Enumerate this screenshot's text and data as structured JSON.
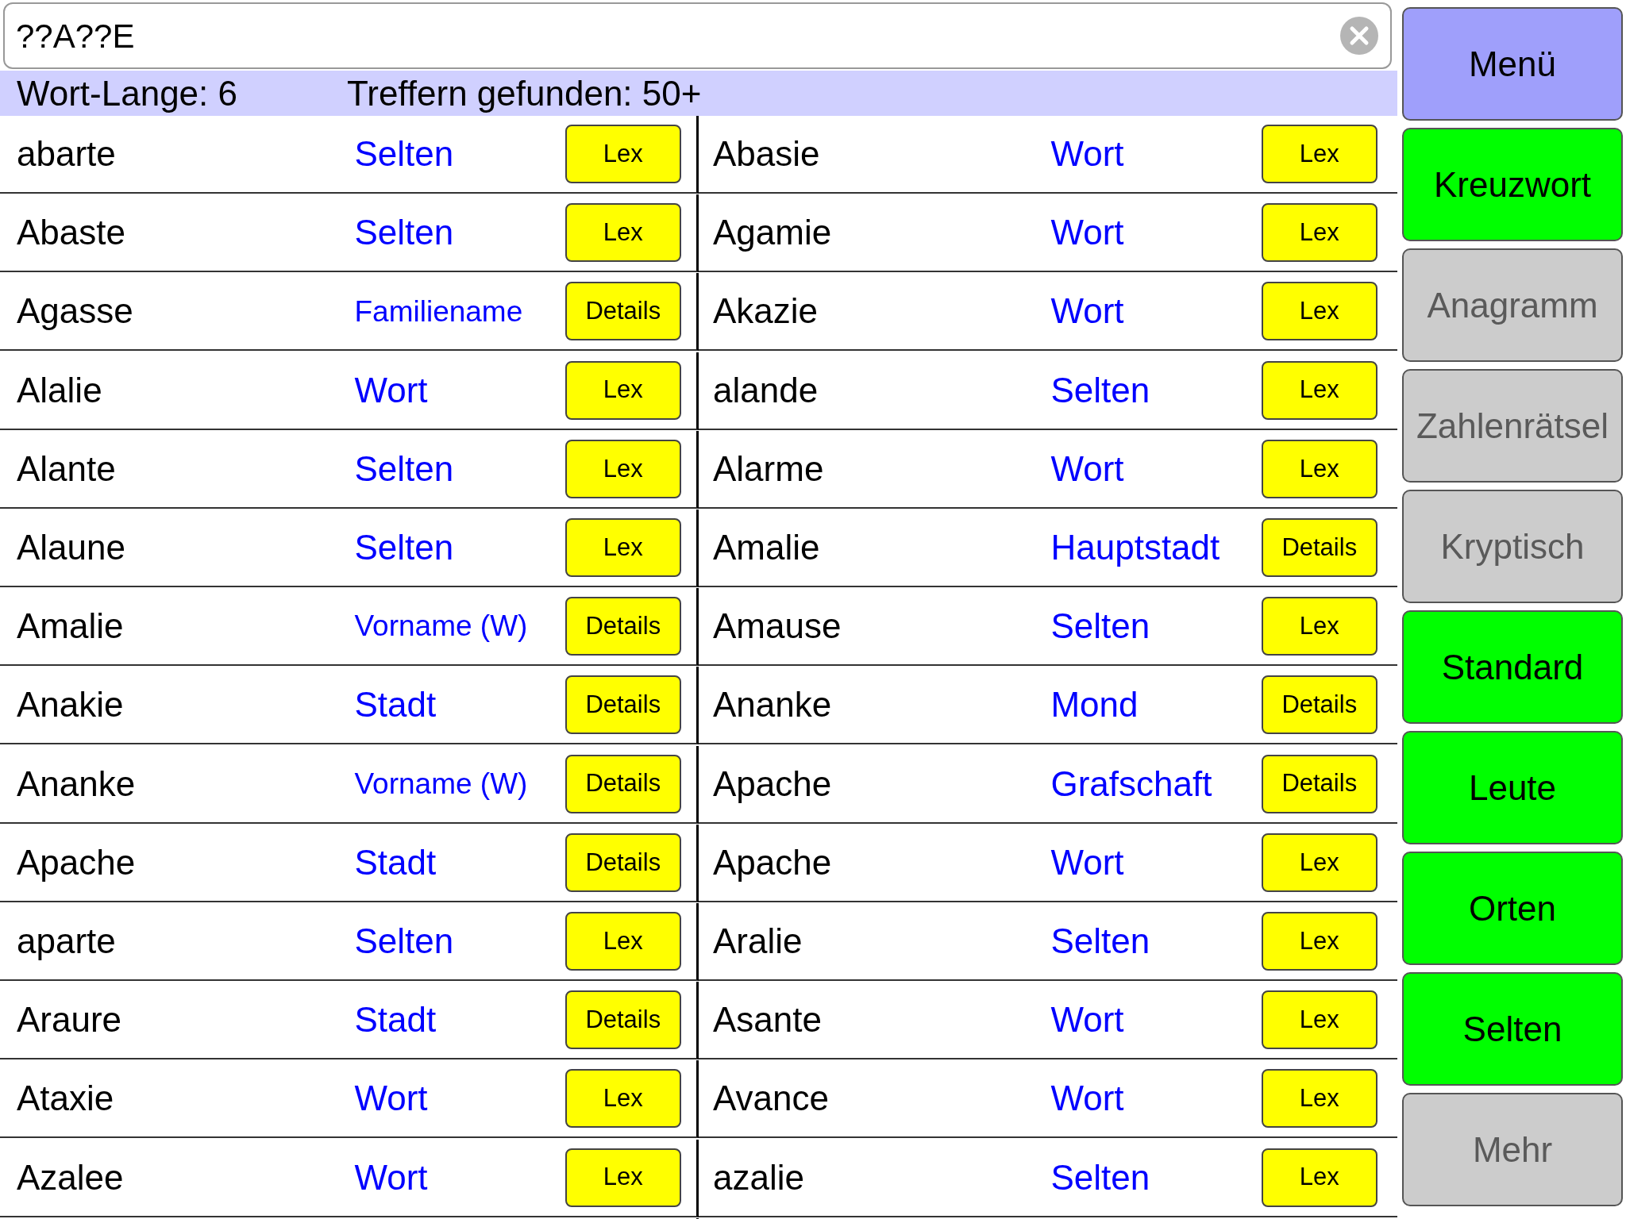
{
  "search": {
    "value": "??A??E"
  },
  "status": {
    "length_label": "Wort-Lange: 6",
    "hits_label": "Treffern gefunden: 50+"
  },
  "results": [
    {
      "word": "abarte",
      "category": "Selten",
      "action": "Lex"
    },
    {
      "word": "Abasie",
      "category": "Wort",
      "action": "Lex"
    },
    {
      "word": "Abaste",
      "category": "Selten",
      "action": "Lex"
    },
    {
      "word": "Agamie",
      "category": "Wort",
      "action": "Lex"
    },
    {
      "word": "Agasse",
      "category": "Familiename",
      "action": "Details"
    },
    {
      "word": "Akazie",
      "category": "Wort",
      "action": "Lex"
    },
    {
      "word": "Alalie",
      "category": "Wort",
      "action": "Lex"
    },
    {
      "word": "alande",
      "category": "Selten",
      "action": "Lex"
    },
    {
      "word": "Alante",
      "category": "Selten",
      "action": "Lex"
    },
    {
      "word": "Alarme",
      "category": "Wort",
      "action": "Lex"
    },
    {
      "word": "Alaune",
      "category": "Selten",
      "action": "Lex"
    },
    {
      "word": "Amalie",
      "category": "Hauptstadt",
      "action": "Details"
    },
    {
      "word": "Amalie",
      "category": "Vorname (W)",
      "action": "Details"
    },
    {
      "word": "Amause",
      "category": "Selten",
      "action": "Lex"
    },
    {
      "word": "Anakie",
      "category": "Stadt",
      "action": "Details"
    },
    {
      "word": "Ananke",
      "category": "Mond",
      "action": "Details"
    },
    {
      "word": "Ananke",
      "category": "Vorname (W)",
      "action": "Details"
    },
    {
      "word": "Apache",
      "category": "Grafschaft",
      "action": "Details"
    },
    {
      "word": "Apache",
      "category": "Stadt",
      "action": "Details"
    },
    {
      "word": "Apache",
      "category": "Wort",
      "action": "Lex"
    },
    {
      "word": "aparte",
      "category": "Selten",
      "action": "Lex"
    },
    {
      "word": "Aralie",
      "category": "Selten",
      "action": "Lex"
    },
    {
      "word": "Araure",
      "category": "Stadt",
      "action": "Details"
    },
    {
      "word": "Asante",
      "category": "Wort",
      "action": "Lex"
    },
    {
      "word": "Ataxie",
      "category": "Wort",
      "action": "Lex"
    },
    {
      "word": "Avance",
      "category": "Wort",
      "action": "Lex"
    },
    {
      "word": "Azalee",
      "category": "Wort",
      "action": "Lex"
    },
    {
      "word": "azalie",
      "category": "Selten",
      "action": "Lex"
    }
  ],
  "sidebar": [
    {
      "label": "Menü",
      "kind": "menu"
    },
    {
      "label": "Kreuzwort",
      "kind": "filter",
      "on": true
    },
    {
      "label": "Anagramm",
      "kind": "filter",
      "on": false
    },
    {
      "label": "Zahlenrätsel",
      "kind": "filter",
      "on": false
    },
    {
      "label": "Kryptisch",
      "kind": "filter",
      "on": false
    },
    {
      "label": "Standard",
      "kind": "filter",
      "on": true
    },
    {
      "label": "Leute",
      "kind": "filter",
      "on": true
    },
    {
      "label": "Orten",
      "kind": "filter",
      "on": true
    },
    {
      "label": "Selten",
      "kind": "filter",
      "on": true
    },
    {
      "label": "Mehr",
      "kind": "filter",
      "on": false
    }
  ]
}
